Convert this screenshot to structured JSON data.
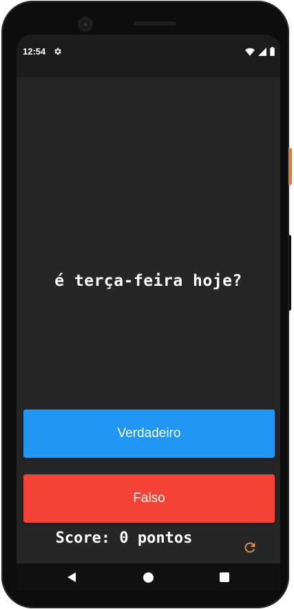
{
  "status_bar": {
    "time": "12:54",
    "icons": [
      "gear-icon",
      "wifi-icon",
      "signal-icon",
      "battery-icon"
    ]
  },
  "quiz": {
    "question": "é terça-feira hoje?",
    "true_label": "Verdadeiro",
    "false_label": "Falso"
  },
  "score": {
    "text": "Score: 0 pontos"
  },
  "colors": {
    "background": "#262626",
    "true_button": "#2196f3",
    "false_button": "#f44336",
    "refresh_icon": "#e8914a"
  },
  "nav_bar": {
    "icons": [
      "back-icon",
      "home-icon",
      "recents-icon"
    ]
  }
}
